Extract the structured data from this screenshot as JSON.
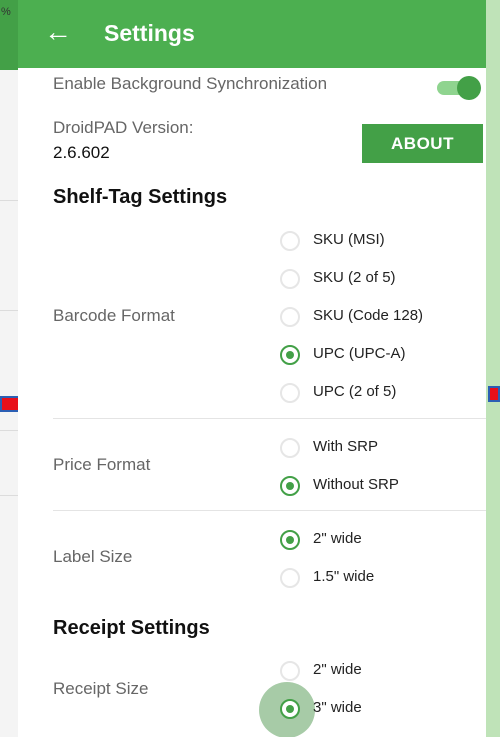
{
  "screen_edge": {
    "status_fragment": "%"
  },
  "appbar": {
    "title": "Settings",
    "back_icon": "arrow-left-icon"
  },
  "sync": {
    "label": "Enable Background Synchronization",
    "enabled": true
  },
  "version": {
    "label": "DroidPAD Version:",
    "value": "2.6.602",
    "about_button": "ABOUT"
  },
  "shelf_tag": {
    "title": "Shelf-Tag Settings",
    "barcode": {
      "label": "Barcode Format",
      "options": [
        "SKU (MSI)",
        "SKU (2 of 5)",
        "SKU (Code 128)",
        "UPC (UPC-A)",
        "UPC (2 of 5)"
      ],
      "selected": "UPC (UPC-A)"
    },
    "price": {
      "label": "Price Format",
      "options": [
        "With SRP",
        "Without SRP"
      ],
      "selected": "Without SRP"
    },
    "label_size": {
      "label": "Label Size",
      "options": [
        "2\" wide",
        "1.5\" wide"
      ],
      "selected": "2\" wide"
    }
  },
  "receipt": {
    "title": "Receipt Settings",
    "size": {
      "label": "Receipt Size",
      "options": [
        "2\" wide",
        "3\" wide"
      ],
      "selected": "3\" wide"
    }
  },
  "colors": {
    "primary": "#4caf50",
    "accent": "#43a047",
    "marker": "#e8101a"
  }
}
